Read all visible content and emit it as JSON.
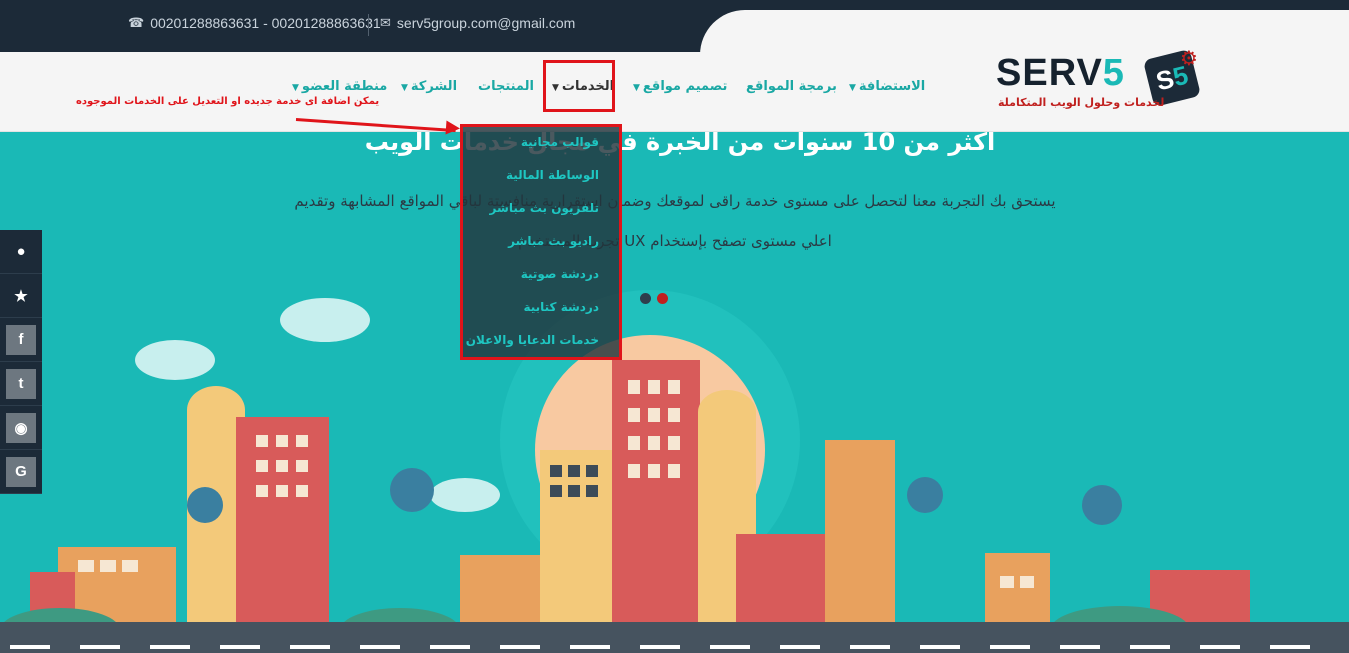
{
  "topbar": {
    "phone": "00201288863631 - 00201288863631",
    "email": "serv5group.com@gmail.com",
    "phone_icon": "phone-icon",
    "email_icon": "envelope-icon"
  },
  "logo": {
    "text_main": "SERV",
    "text_num": "5",
    "badge_s": "S",
    "badge_num": "5",
    "tagline": "لخدمات وحلول الويب المتكاملة"
  },
  "nav": {
    "hosting": "الاستضافة",
    "programming": "برمجة المواقع",
    "design": "تصميم مواقع",
    "services": "الخدمات",
    "products": "المنتجات",
    "company": "الشركة",
    "members": "منطقة العضو"
  },
  "annotation": "يمكن اضافة اى خدمة جديده او التعديل على الخدمات الموجوده",
  "hero": {
    "title": "أكثر من 10 سنوات من الخبرة في مجال خدمات الويب",
    "line1": "يستحق بك التجربة معنا لتحصل على مستوى خدمة راقى لموقعك وضمان استقرارية منافستة لباقي المواقع المشابهة وتقديم",
    "line2": "اعلي مستوى تصفح بإستخدام UX تجربة المستخدم"
  },
  "dropdown": [
    "قوالب مجانية",
    "الوساطة المالية",
    "تلفزيون بث مباشر",
    "راديو بث مباشر",
    "دردشة صوتية",
    "دردشة كتابية",
    "خدمات الدعايا والاعلان"
  ],
  "social": [
    "user-icon",
    "star-icon",
    "facebook-icon",
    "twitter-icon",
    "pinterest-icon",
    "google-icon"
  ],
  "colors": {
    "teal": "#1ab9b6",
    "navy": "#1c2a38",
    "red": "#e0141a"
  }
}
